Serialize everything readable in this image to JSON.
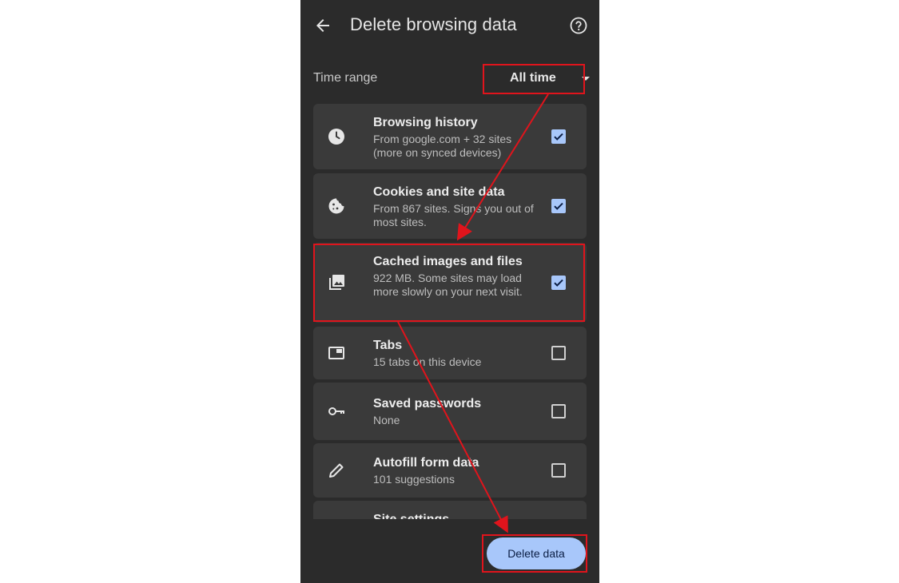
{
  "header": {
    "title": "Delete browsing data",
    "back_icon": "arrow-back-icon",
    "help_icon": "help-circle-icon"
  },
  "time_range": {
    "label": "Time range",
    "selected": "All time"
  },
  "items": [
    {
      "icon": "clock-icon",
      "label": "Browsing history",
      "sub": "From google.com + 32 sites (more on synced devices)",
      "checked": true
    },
    {
      "icon": "cookie-icon",
      "label": "Cookies and site data",
      "sub": "From 867 sites. Signs you out of most sites.",
      "checked": true
    },
    {
      "icon": "image-stack-icon",
      "label": "Cached images and files",
      "sub": "922 MB. Some sites may load more slowly on your next visit.",
      "checked": true
    },
    {
      "icon": "tab-icon",
      "label": "Tabs",
      "sub": "15 tabs on this device",
      "checked": false
    },
    {
      "icon": "key-icon",
      "label": "Saved passwords",
      "sub": "None",
      "checked": false
    },
    {
      "icon": "pencil-icon",
      "label": "Autofill form data",
      "sub": "101 suggestions",
      "checked": false
    },
    {
      "icon": "settings-icon",
      "label": "Site settings",
      "sub": "",
      "checked": false
    }
  ],
  "actions": {
    "delete_label": "Delete data"
  },
  "colors": {
    "background": "#2b2b2b",
    "card": "#3a3a3a",
    "accent": "#a8c7fa",
    "annotation": "#e0141c"
  }
}
